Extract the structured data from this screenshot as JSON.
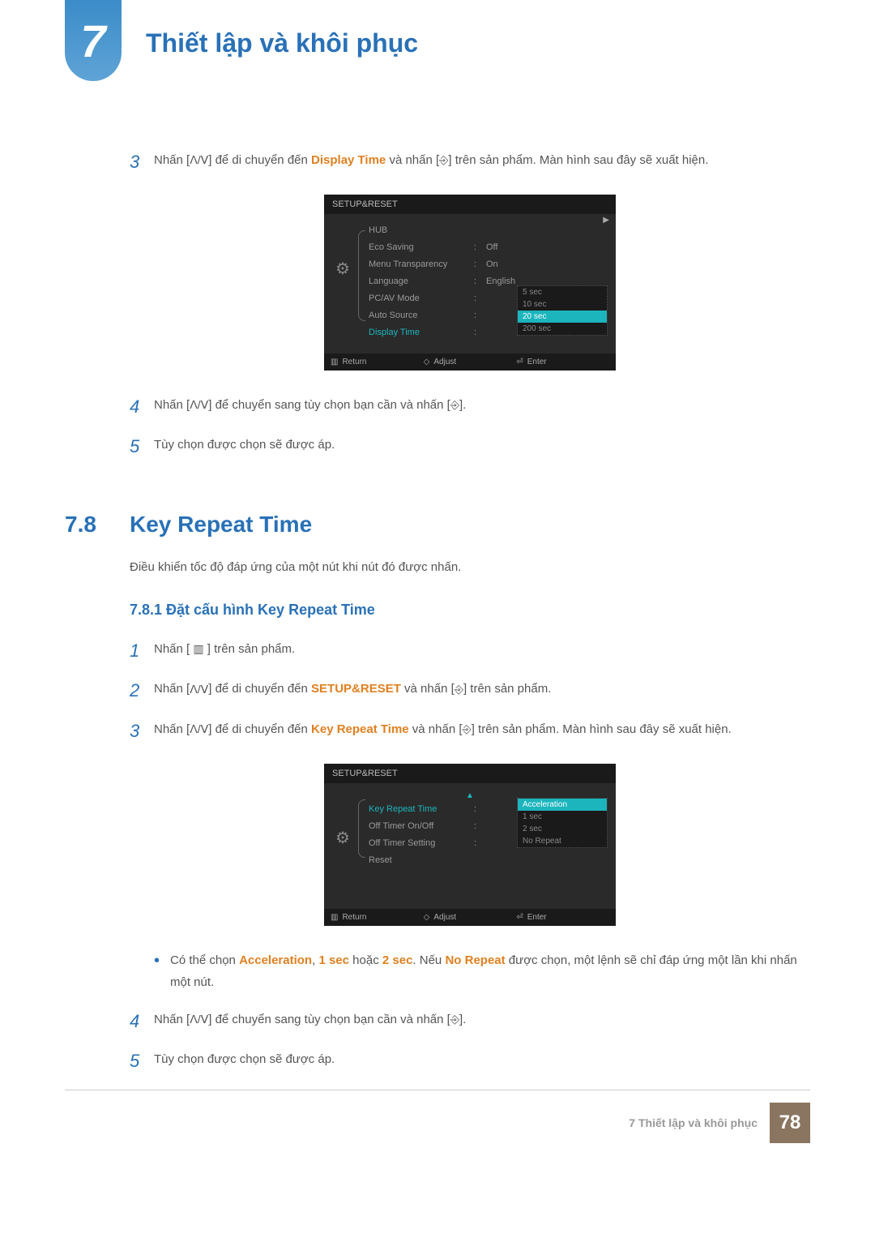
{
  "header": {
    "chapter_num": "7",
    "chapter_title": "Thiết lập và khôi phục"
  },
  "step3": {
    "num": "3",
    "a": "Nhấn [",
    "b": "] để di chuyển đến ",
    "c": "Display Time",
    "d": " và nhấn [",
    "e": "] trên sản phẩm. Màn hình sau đây sẽ xuất hiện."
  },
  "osd1": {
    "title": "SETUP&RESET",
    "rows": [
      {
        "label": "HUB",
        "colon": "",
        "value": ""
      },
      {
        "label": "Eco Saving",
        "colon": ":",
        "value": "Off"
      },
      {
        "label": "Menu Transparency",
        "colon": ":",
        "value": "On"
      },
      {
        "label": "Language",
        "colon": ":",
        "value": "English"
      },
      {
        "label": "PC/AV Mode",
        "colon": ":",
        "value": ""
      },
      {
        "label": "Auto Source",
        "colon": ":",
        "value": ""
      },
      {
        "label": "Display Time",
        "colon": ":",
        "value": "",
        "hl": true
      }
    ],
    "options": [
      {
        "t": "5 sec"
      },
      {
        "t": "10 sec"
      },
      {
        "t": "20 sec",
        "sel": true
      },
      {
        "t": "200 sec"
      }
    ],
    "footer": {
      "return": "Return",
      "adjust": "Adjust",
      "enter": "Enter"
    }
  },
  "step4": {
    "num": "4",
    "a": "Nhấn [",
    "b": "] để chuyển sang tùy chọn bạn cần và nhấn [",
    "c": "]."
  },
  "step5": {
    "num": "5",
    "text": "Tùy chọn được chọn sẽ được áp."
  },
  "section": {
    "num": "7.8",
    "title": "Key Repeat Time"
  },
  "desc": "Điều khiển tốc độ đáp ứng của một nút khi nút đó được nhấn.",
  "subsection": "7.8.1  Đặt cấu hình Key Repeat Time",
  "s1": {
    "num": "1",
    "a": "Nhấn [ ",
    "b": " ] trên sản phẩm."
  },
  "s2": {
    "num": "2",
    "a": "Nhấn [",
    "b": "] để di chuyển đến ",
    "c": "SETUP&RESET",
    "d": " và nhấn [",
    "e": "] trên sản phẩm."
  },
  "s3": {
    "num": "3",
    "a": "Nhấn [",
    "b": "] để di chuyển đến ",
    "c": "Key Repeat Time",
    "d": " và nhấn [",
    "e": "] trên sản phẩm. Màn hình sau đây sẽ xuất hiện."
  },
  "osd2": {
    "title": "SETUP&RESET",
    "rows": [
      {
        "label": "Key Repeat Time",
        "colon": ":",
        "value": "",
        "hl": true
      },
      {
        "label": "Off Timer On/Off",
        "colon": ":",
        "value": ""
      },
      {
        "label": "Off Timer Setting",
        "colon": ":",
        "value": ""
      },
      {
        "label": "Reset",
        "colon": "",
        "value": ""
      }
    ],
    "options": [
      {
        "t": "Acceleration",
        "sel": true
      },
      {
        "t": "1 sec"
      },
      {
        "t": "2 sec"
      },
      {
        "t": "No Repeat"
      }
    ],
    "footer": {
      "return": "Return",
      "adjust": "Adjust",
      "enter": "Enter"
    }
  },
  "bullet": {
    "a": "Có thể chọn ",
    "b": "Acceleration",
    "c": ", ",
    "d": "1 sec",
    "e": " hoặc ",
    "f": "2 sec",
    "g": ". Nếu ",
    "h": "No Repeat",
    "i": " được chọn, một lệnh sẽ chỉ đáp ứng một lần khi nhấn một nút."
  },
  "s4": {
    "num": "4",
    "a": "Nhấn [",
    "b": "] để chuyển sang tùy chọn bạn cần và nhấn [",
    "c": "]."
  },
  "s5": {
    "num": "5",
    "text": "Tùy chọn được chọn sẽ được áp."
  },
  "footer_text": "7 Thiết lập và khôi phục",
  "page_num": "78",
  "glyphs": {
    "updown": "ᐱ/ᐯ",
    "enter": "⎆",
    "menu": "▥",
    "gear": "⚙",
    "ret": "▥",
    "adj": "◇",
    "ent": "⏎",
    "tri_up": "▲",
    "tri_right": "▶"
  }
}
